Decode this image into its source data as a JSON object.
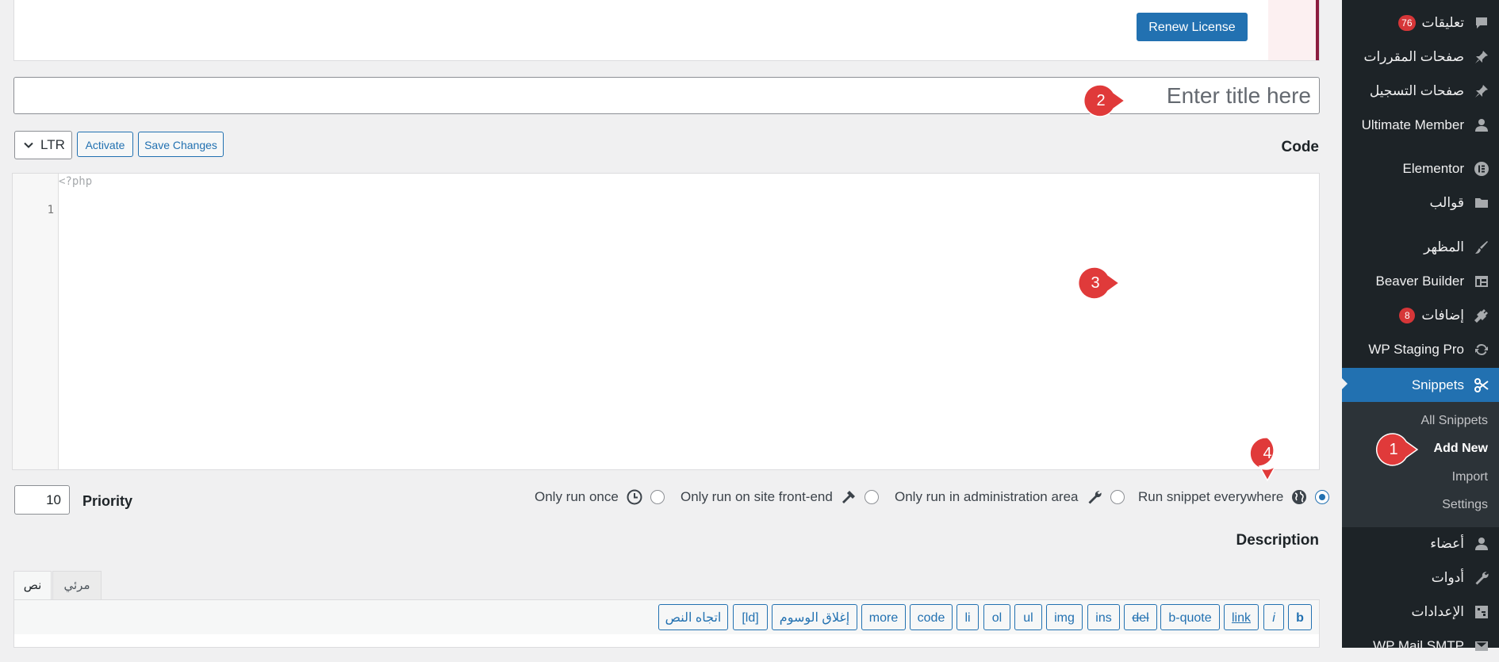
{
  "license": {
    "renew_label": "Renew License"
  },
  "title_field": {
    "placeholder": "Enter title here",
    "value": ""
  },
  "toolbar": {
    "direction_value": "LTR",
    "activate_label": "Activate",
    "save_label": "Save Changes"
  },
  "code_section": {
    "heading": "Code",
    "php_open_tag": "<?php",
    "line_numbers": [
      "1"
    ]
  },
  "priority": {
    "label": "Priority",
    "value": "10"
  },
  "scope_options": [
    {
      "label": "Run snippet everywhere",
      "icon": "globe-icon",
      "selected": true
    },
    {
      "label": "Only run in administration area",
      "icon": "wrench-icon",
      "selected": false
    },
    {
      "label": "Only run on site front-end",
      "icon": "hammer-icon",
      "selected": false
    },
    {
      "label": "Only run once",
      "icon": "clock-icon",
      "selected": false
    }
  ],
  "description": {
    "heading": "Description",
    "tabs": [
      {
        "label": "نص",
        "active": true
      },
      {
        "label": "مرئي",
        "active": false
      }
    ],
    "quicktags": [
      "b",
      "i",
      "link",
      "b-quote",
      "del",
      "ins",
      "img",
      "ul",
      "ol",
      "li",
      "code",
      "more",
      "إغلاق الوسوم",
      "[ld]",
      "اتجاه النص"
    ]
  },
  "sidebar": {
    "items": [
      {
        "label": "تعليقات",
        "icon": "comment-icon",
        "badge": "76"
      },
      {
        "label": "صفحات المقررات",
        "icon": "pin-icon"
      },
      {
        "label": "صفحات التسجيل",
        "icon": "pin-icon"
      },
      {
        "label": "Ultimate Member",
        "icon": "user-icon"
      },
      {
        "label": "Elementor",
        "icon": "elementor-icon"
      },
      {
        "label": "قوالب",
        "icon": "folder-icon"
      },
      {
        "label": "المظهر",
        "icon": "brush-icon"
      },
      {
        "label": "Beaver Builder",
        "icon": "table-icon"
      },
      {
        "label": "إضافات",
        "icon": "plugin-icon",
        "badge": "8"
      },
      {
        "label": "WP Staging Pro",
        "icon": "sync-icon"
      },
      {
        "label": "Snippets",
        "icon": "scissors-icon",
        "active": true
      },
      {
        "label": "أعضاء",
        "icon": "user-icon"
      },
      {
        "label": "أدوات",
        "icon": "wrench-icon"
      },
      {
        "label": "الإعدادات",
        "icon": "settings-icon"
      },
      {
        "label": "WP Mail SMTP",
        "icon": "mail-icon"
      }
    ],
    "submenu": [
      {
        "label": "All Snippets"
      },
      {
        "label": "Add New",
        "current": true
      },
      {
        "label": "Import"
      },
      {
        "label": "Settings"
      }
    ]
  },
  "callouts": [
    "1",
    "2",
    "3",
    "4"
  ],
  "colors": {
    "accent": "#2271b1",
    "sidebar_bg": "#1d2327",
    "callout": "#e03a3a",
    "badge": "#d63638"
  }
}
